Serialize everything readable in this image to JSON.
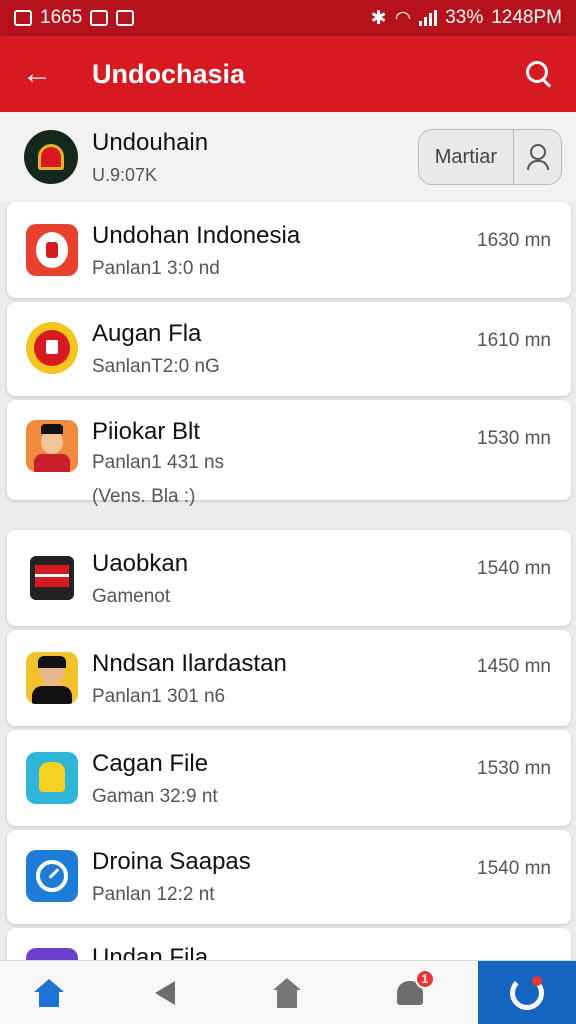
{
  "colors": {
    "status_bar": "#b5121b",
    "app_bar": "#d71921",
    "nav_active": "#1565c0",
    "badge": "#e53935"
  },
  "status_bar": {
    "left_text": "1665",
    "battery": "33%",
    "time": "1248PM"
  },
  "app_bar": {
    "back_icon": "arrow-left-icon",
    "title": "Undochasia",
    "search_icon": "search-icon"
  },
  "profile": {
    "name": "Undouhain",
    "sub": "U.9:07K",
    "button_label": "Martiar",
    "user_icon": "user-icon"
  },
  "items": [
    {
      "name": "Undohan Indonesia",
      "sub": "Panlan1 3:0 nd",
      "time": "1630 mn"
    },
    {
      "name": "Augan Fla",
      "sub": "SanlanT2:0 nG",
      "time": "1610 mn"
    },
    {
      "name": "Piiokar Blt",
      "sub": "Panlan1 431 ns",
      "sub2": "(Vens. Bla :)",
      "time": "1530 mn"
    },
    {
      "name": "Uaobkan",
      "sub": "Gamenot",
      "time": "1540 mn"
    },
    {
      "name": "Nndsan Ilardastan",
      "sub": "Panlan1 301 n6",
      "time": "1450 mn"
    },
    {
      "name": "Cagan File",
      "sub": "Gaman 32:9 nt",
      "time": "1530 mn"
    },
    {
      "name": "Droina Saapas",
      "sub": "Panlan 12:2 nt",
      "time": "1540 mn"
    },
    {
      "name": "Undan Fila"
    }
  ],
  "bottom_nav": {
    "badge_count": "1"
  }
}
